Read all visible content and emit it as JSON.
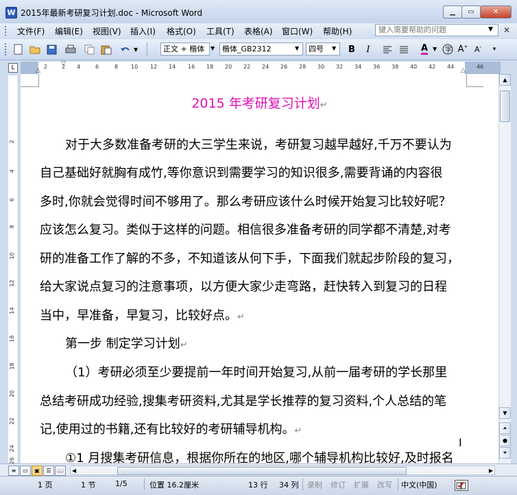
{
  "window": {
    "title": "2015年最新考研复习计划.doc - Microsoft Word",
    "app_letter": "W"
  },
  "menu": {
    "items": [
      "文件(F)",
      "编辑(E)",
      "视图(V)",
      "插入(I)",
      "格式(O)",
      "工具(T)",
      "表格(A)",
      "窗口(W)",
      "帮助(H)"
    ],
    "help_placeholder": "键入需要帮助的问题"
  },
  "toolbar": {
    "style_value": "正文 + 楷体",
    "font_value": "楷体_GB2312",
    "size_value": "四号"
  },
  "ruler": {
    "h_ticks": [
      "2",
      "2",
      "4",
      "6",
      "8",
      "10",
      "12",
      "14",
      "16",
      "18",
      "20",
      "22",
      "24",
      "26",
      "28",
      "30",
      "32",
      "34",
      "36",
      "38",
      "40",
      "42",
      "44",
      "46"
    ],
    "v_ticks": [
      "2",
      "4",
      "6",
      "8",
      "10",
      "12",
      "14",
      "16",
      "18",
      "20",
      "22",
      "24",
      "26"
    ]
  },
  "document": {
    "title": "2015 年考研复习计划",
    "paragraphs": [
      "对于大多数准备考研的大三学生来说，考研复习越早越好,千万不要认为",
      "自己基础好就胸有成竹,等你意识到需要学习的知识很多,需要背诵的内容很",
      "多时,你就会觉得时间不够用了。那么考研应该什么时候开始复习比较好呢？",
      "应该怎么复习。类似于这样的问题。相信很多准备考研的同学都不清楚,对考",
      "研的准备工作了解的不多，不知道该从何下手，下面我们就起步阶段的复习，",
      "给大家说点复习的注意事项，以方便大家少走弯路，赶快转入到复习的日程",
      "当中，早准备，早复习，比较好点。"
    ],
    "heading1": "第一步  制定学习计划",
    "paragraphs2": [
      "（1）考研必须至少要提前一年时间开始复习,从前一届考研的学长那里",
      "总结考研成功经验,搜集考研资料,尤其是学长推荐的复习资料,个人总结的笔",
      "记,使用过的书籍,还有比较好的考研辅导机构。"
    ],
    "last_line": "①1 月搜集考研信息，根据你所在的地区,哪个辅导机构比较好,及时报名",
    "para_mark": "↵"
  },
  "status": {
    "page": "1 页",
    "section": "1 节",
    "pages": "1/5",
    "position": "位置 16.2厘米",
    "line": "13 行",
    "column": "34 列",
    "rec": "录制",
    "trk": "修订",
    "ext": "扩展",
    "ovr": "改写",
    "lang": "中文(中国)"
  }
}
